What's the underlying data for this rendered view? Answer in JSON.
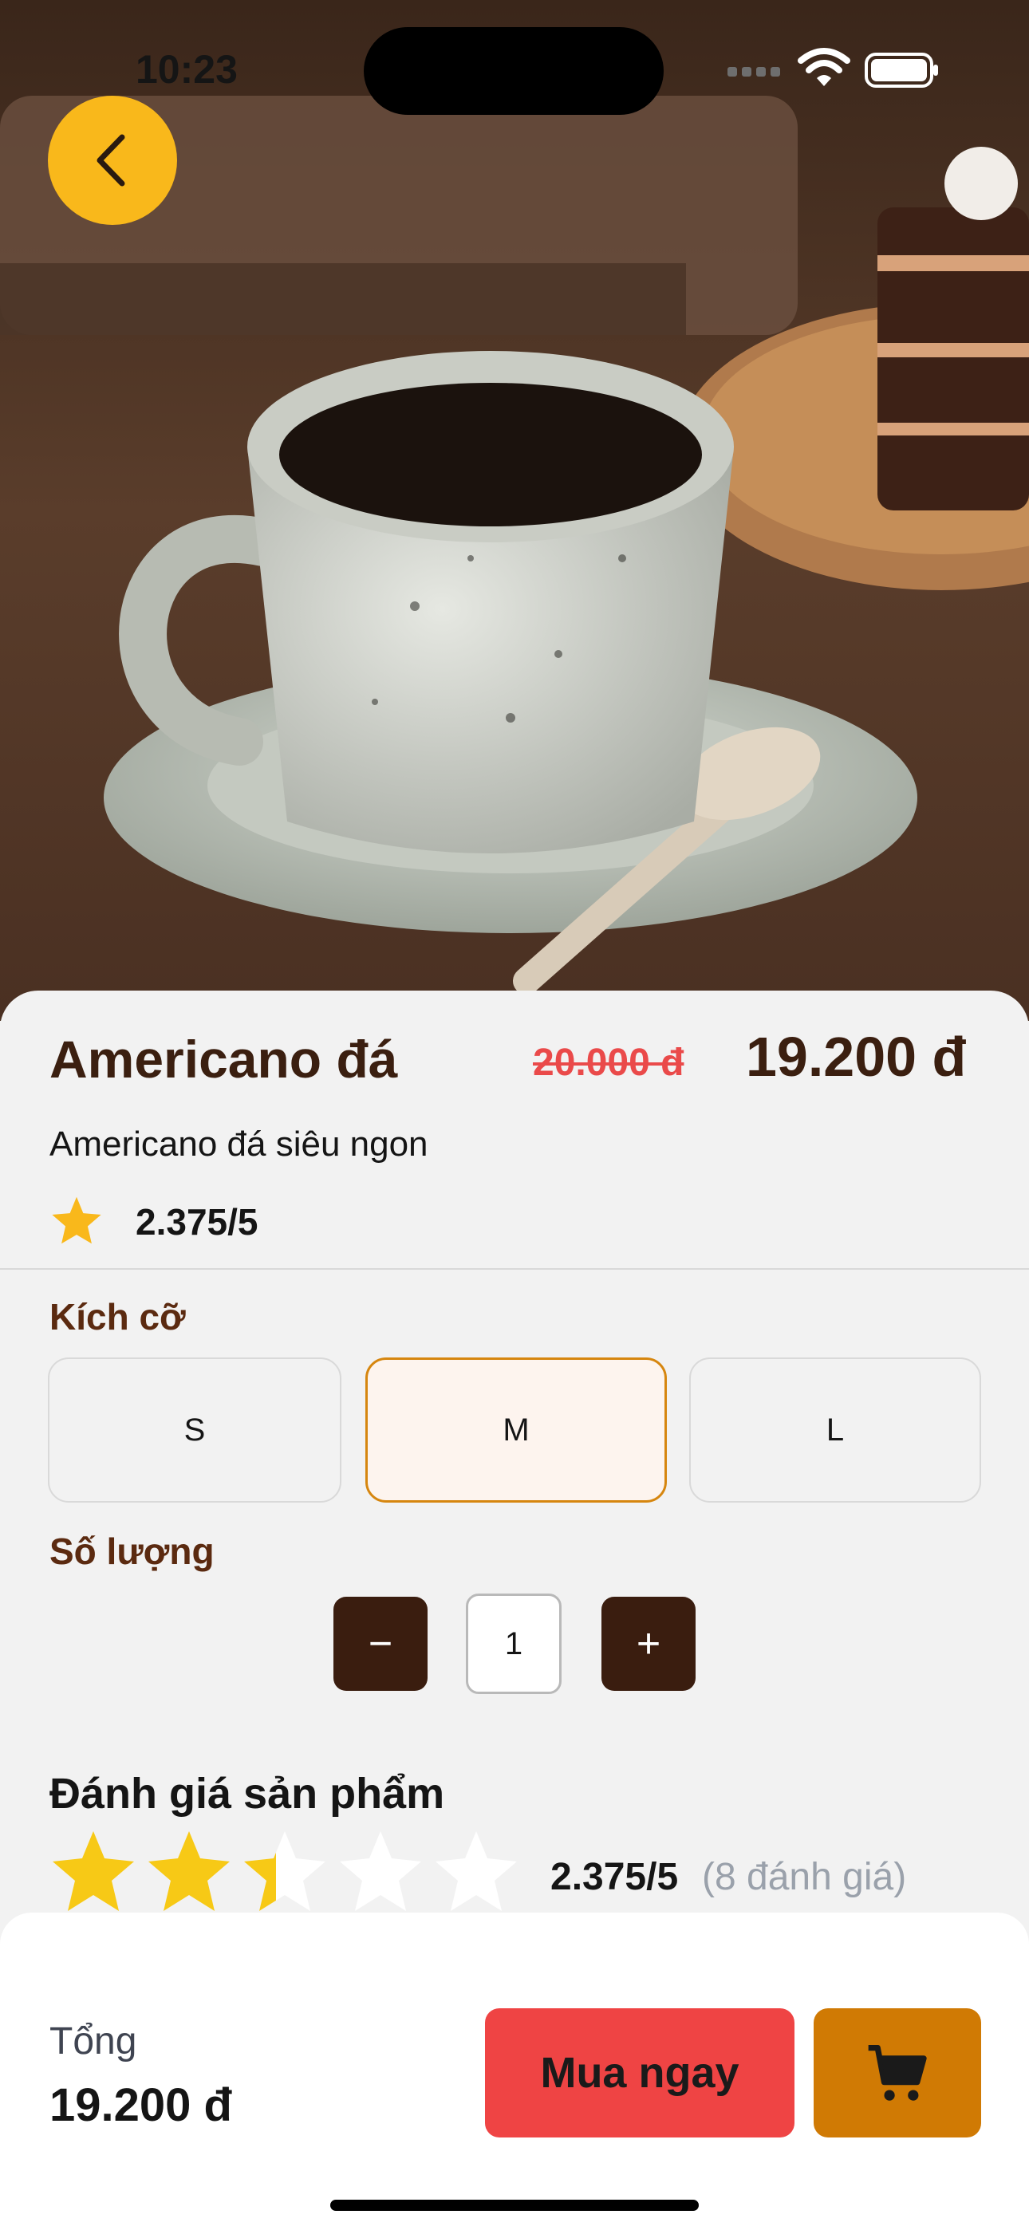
{
  "status_bar": {
    "time": "10:23"
  },
  "product": {
    "name": "Americano đá",
    "original_price": "20.000 đ",
    "price": "19.200 đ",
    "description": "Americano đá siêu ngon",
    "rating_text": "2.375/5",
    "rating_value": 2.375
  },
  "size": {
    "label": "Kích cỡ",
    "options": [
      "S",
      "M",
      "L"
    ],
    "selected": "M"
  },
  "quantity": {
    "label": "Số lượng",
    "minus": "−",
    "value": "1",
    "plus": "+"
  },
  "reviews": {
    "title": "Đánh giá sản phẩm",
    "rating_text": "2.375/5",
    "count_text": "(8 đánh giá)",
    "rating_value": 2.375
  },
  "footer": {
    "total_label": "Tổng",
    "total_value": "19.200 đ",
    "buy_label": "Mua ngay"
  },
  "colors": {
    "accent_yellow": "#f9b81b",
    "brown": "#3a1d0f",
    "buy_red": "#ef4444",
    "cart_orange": "#d07a04"
  },
  "icons": {
    "back": "chevron-left-icon",
    "cart": "shopping-cart-icon",
    "star": "star-icon"
  }
}
